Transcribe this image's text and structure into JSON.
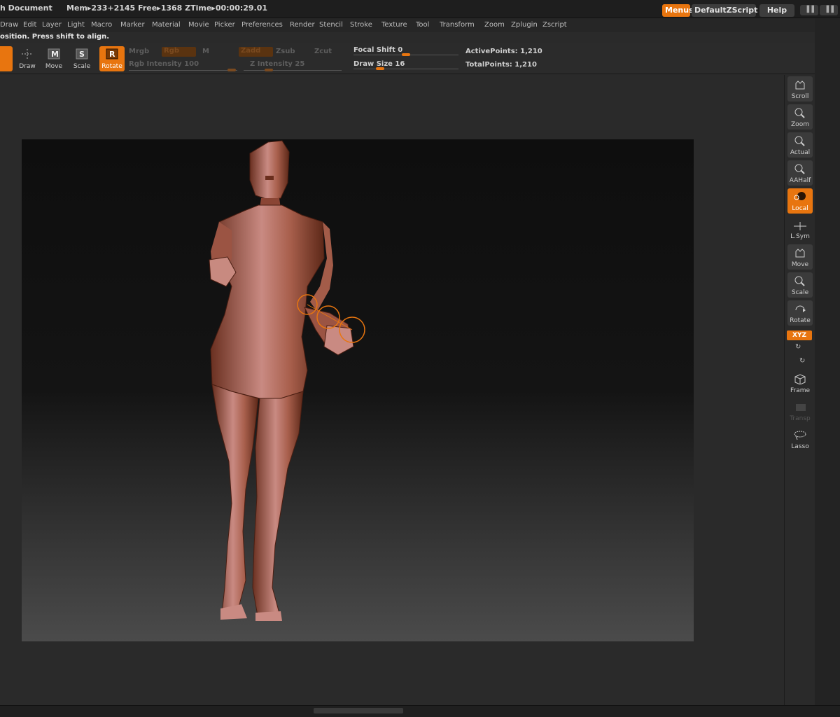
{
  "title": {
    "document": "h Document",
    "memory": "Mem▸233+2145  Free▸1368  ZTime▸00:00:29.01"
  },
  "top_buttons": {
    "menus": "Menus",
    "zscript": "DefaultZScript",
    "help": "Help"
  },
  "menu": [
    "Draw",
    "Edit",
    "Layer",
    "Light",
    "Macro",
    "Marker",
    "Material",
    "Movie",
    "Picker",
    "Preferences",
    "Render",
    "Stencil",
    "Stroke",
    "Texture",
    "Tool",
    "Transform",
    "Zoom",
    "Zplugin",
    "Zscript"
  ],
  "notice": "osition. Press shift to align.",
  "shelf": {
    "draw": "Draw",
    "move": "Move",
    "scale": "Scale",
    "rotate": "Rotate",
    "mrgb": "Mrgb",
    "rgb": "Rgb",
    "m": "M",
    "zadd": "Zadd",
    "zsub": "Zsub",
    "zcut": "Zcut",
    "rgb_intensity": "Rgb  Intensity 100",
    "z_intensity": "Z  Intensity 25",
    "focal_shift": "Focal  Shift 0",
    "draw_size": "Draw  Size 16",
    "active_points": "ActivePoints: 1,210",
    "total_points": "TotalPoints: 1,210"
  },
  "right_shelf": {
    "scroll": "Scroll",
    "zoom": "Zoom",
    "actual": "Actual",
    "aahalf": "AAHalf",
    "local": "Local",
    "lsym": "L.Sym",
    "move": "Move",
    "scale": "Scale",
    "rotate": "Rotate",
    "xyz": "XYZ",
    "frame": "Frame",
    "transp": "Transp",
    "lasso": "Lasso"
  },
  "colors": {
    "accent": "#e8750f",
    "model": "#b0604a"
  }
}
